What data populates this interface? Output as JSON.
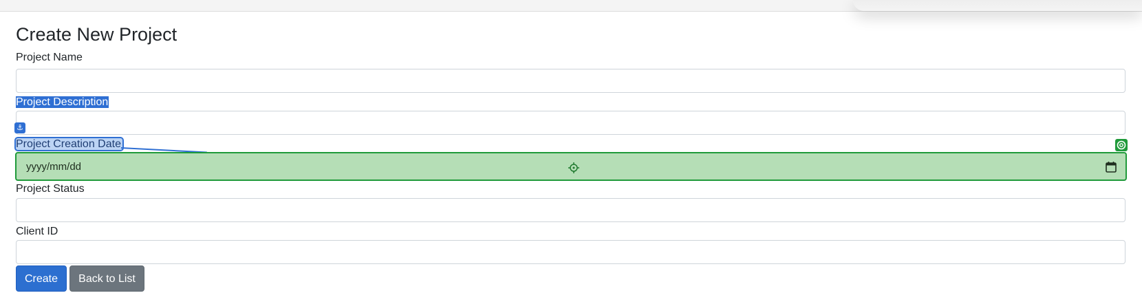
{
  "form": {
    "title": "Create New Project",
    "fields": [
      {
        "label": "Project Name",
        "value": ""
      },
      {
        "label": "Project Description",
        "value": ""
      },
      {
        "label": "Project Creation Date",
        "placeholder": "yyyy/mm/dd"
      },
      {
        "label": "Project Status",
        "value": ""
      },
      {
        "label": "Client ID",
        "value": ""
      }
    ]
  },
  "buttons": {
    "create": "Create",
    "back": "Back to List"
  },
  "annotations": {
    "anchor_glyph": "⚓",
    "anchor_icon": "anchor-icon",
    "target_icon": "crosshair-icon",
    "colors": {
      "anchor": "#2f6fd3",
      "target": "#1f9a3a",
      "target_fill": "#b5deb6"
    }
  }
}
